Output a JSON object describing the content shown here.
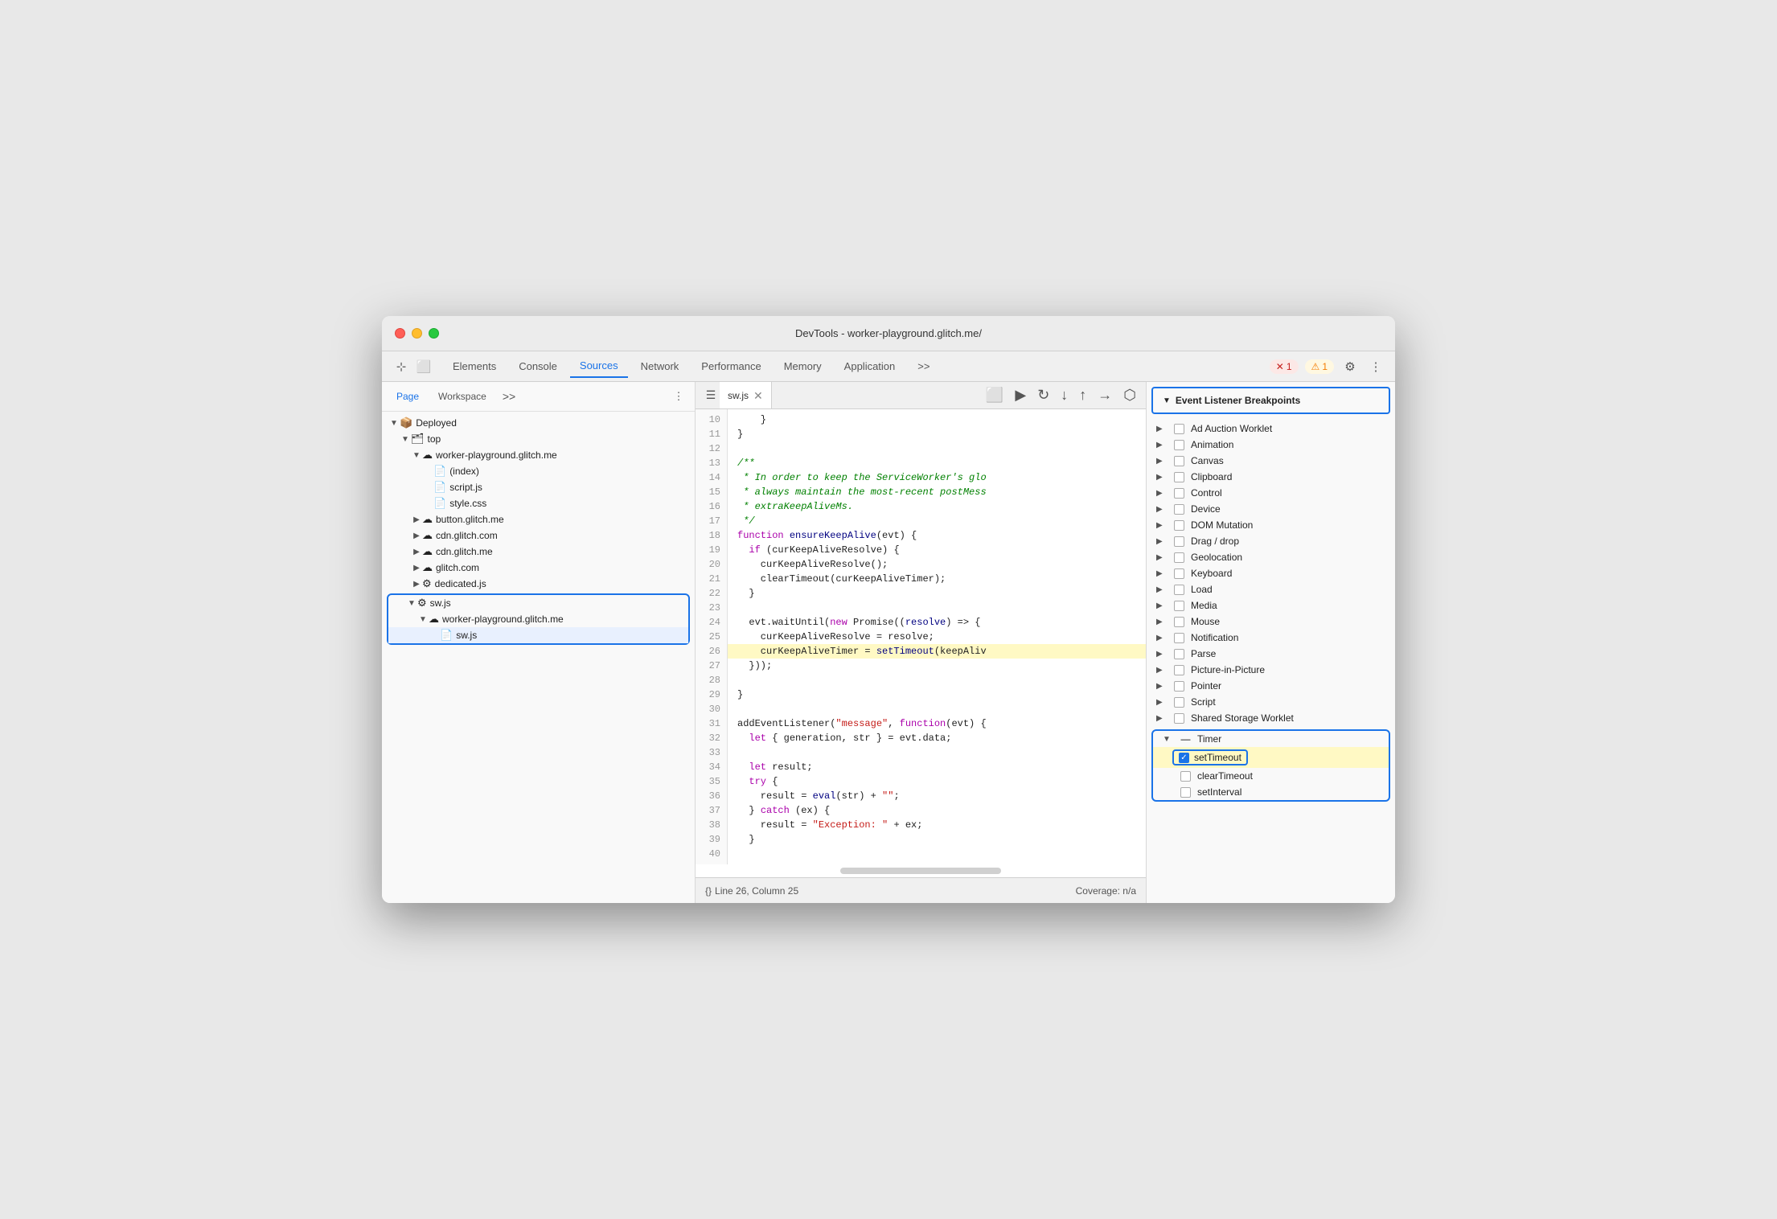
{
  "window": {
    "title": "DevTools - worker-playground.glitch.me/"
  },
  "tabs": [
    {
      "id": "elements",
      "label": "Elements"
    },
    {
      "id": "console",
      "label": "Console"
    },
    {
      "id": "sources",
      "label": "Sources",
      "active": true
    },
    {
      "id": "network",
      "label": "Network"
    },
    {
      "id": "performance",
      "label": "Performance"
    },
    {
      "id": "memory",
      "label": "Memory"
    },
    {
      "id": "application",
      "label": "Application"
    },
    {
      "id": "more",
      "label": ">>"
    }
  ],
  "error_count": "1",
  "warn_count": "1",
  "sidebar": {
    "tabs": [
      {
        "id": "page",
        "label": "Page",
        "active": true
      },
      {
        "id": "workspace",
        "label": "Workspace"
      },
      {
        "id": "more",
        "label": ">>"
      }
    ],
    "tree": [
      {
        "indent": 0,
        "toggle": "▼",
        "icon": "📦",
        "label": "Deployed"
      },
      {
        "indent": 1,
        "toggle": "▼",
        "icon": "🗂",
        "label": "top"
      },
      {
        "indent": 2,
        "toggle": "▼",
        "icon": "☁",
        "label": "worker-playground.glitch.me"
      },
      {
        "indent": 3,
        "toggle": "",
        "icon": "📄",
        "label": "(index)"
      },
      {
        "indent": 3,
        "toggle": "",
        "icon": "🟧",
        "label": "script.js"
      },
      {
        "indent": 3,
        "toggle": "",
        "icon": "🟪",
        "label": "style.css"
      },
      {
        "indent": 2,
        "toggle": "▶",
        "icon": "☁",
        "label": "button.glitch.me"
      },
      {
        "indent": 2,
        "toggle": "▶",
        "icon": "☁",
        "label": "cdn.glitch.com"
      },
      {
        "indent": 2,
        "toggle": "▶",
        "icon": "☁",
        "label": "cdn.glitch.me"
      },
      {
        "indent": 2,
        "toggle": "▶",
        "icon": "☁",
        "label": "glitch.com"
      },
      {
        "indent": 2,
        "toggle": "▶",
        "icon": "⚙",
        "label": "dedicated.js"
      },
      {
        "indent": 1,
        "toggle": "▼",
        "icon": "⚙",
        "label": "sw.js",
        "highlight_start": true
      },
      {
        "indent": 2,
        "toggle": "▼",
        "icon": "☁",
        "label": "worker-playground.glitch.me"
      },
      {
        "indent": 3,
        "toggle": "",
        "icon": "🟧",
        "label": "sw.js",
        "highlight_end": true
      }
    ]
  },
  "editor": {
    "file_tab": "sw.js",
    "lines": [
      {
        "num": 10,
        "code": "    }"
      },
      {
        "num": 11,
        "code": "}"
      },
      {
        "num": 12,
        "code": ""
      },
      {
        "num": 13,
        "code": "/**"
      },
      {
        "num": 14,
        "code": " * In order to keep the ServiceWorker's glo"
      },
      {
        "num": 15,
        "code": " * always maintain the most-recent postMess"
      },
      {
        "num": 16,
        "code": " * extraKeepAliveMs."
      },
      {
        "num": 17,
        "code": " */"
      },
      {
        "num": 18,
        "code": "function ensureKeepAlive(evt) {"
      },
      {
        "num": 19,
        "code": "  if (curKeepAliveResolve) {"
      },
      {
        "num": 20,
        "code": "    curKeepAliveResolve();"
      },
      {
        "num": 21,
        "code": "    clearTimeout(curKeepAliveTimer);"
      },
      {
        "num": 22,
        "code": "  }"
      },
      {
        "num": 23,
        "code": ""
      },
      {
        "num": 24,
        "code": "  evt.waitUntil(new Promise((resolve) => {"
      },
      {
        "num": 25,
        "code": "    curKeepAliveResolve = resolve;"
      },
      {
        "num": 26,
        "code": "    curKeepAliveTimer = setTimeout(keepAliv",
        "highlight": true
      },
      {
        "num": 27,
        "code": "  }));"
      },
      {
        "num": 28,
        "code": ""
      },
      {
        "num": 29,
        "code": "}"
      },
      {
        "num": 30,
        "code": ""
      },
      {
        "num": 31,
        "code": "addEventListener(\"message\", function(evt) {"
      },
      {
        "num": 32,
        "code": "  let { generation, str } = evt.data;"
      },
      {
        "num": 33,
        "code": ""
      },
      {
        "num": 34,
        "code": "  let result;"
      },
      {
        "num": 35,
        "code": "  try {"
      },
      {
        "num": 36,
        "code": "    result = eval(str) + \"\";"
      },
      {
        "num": 37,
        "code": "  } catch (ex) {"
      },
      {
        "num": 38,
        "code": "    result = \"Exception: \" + ex;"
      },
      {
        "num": 39,
        "code": "  }"
      },
      {
        "num": 40,
        "code": ""
      }
    ],
    "status": {
      "line": "26",
      "col": "25",
      "coverage": "Coverage: n/a"
    }
  },
  "breakpoints": {
    "header": "Event Listener Breakpoints",
    "items": [
      {
        "id": "ad-auction",
        "label": "Ad Auction Worklet",
        "toggle": "▶",
        "checked": false
      },
      {
        "id": "animation",
        "label": "Animation",
        "toggle": "▶",
        "checked": false
      },
      {
        "id": "canvas",
        "label": "Canvas",
        "toggle": "▶",
        "checked": false
      },
      {
        "id": "clipboard",
        "label": "Clipboard",
        "toggle": "▶",
        "checked": false
      },
      {
        "id": "control",
        "label": "Control",
        "toggle": "▶",
        "checked": false
      },
      {
        "id": "device",
        "label": "Device",
        "toggle": "▶",
        "checked": false
      },
      {
        "id": "dom-mutation",
        "label": "DOM Mutation",
        "toggle": "▶",
        "checked": false
      },
      {
        "id": "drag-drop",
        "label": "Drag / drop",
        "toggle": "▶",
        "checked": false
      },
      {
        "id": "geolocation",
        "label": "Geolocation",
        "toggle": "▶",
        "checked": false
      },
      {
        "id": "keyboard",
        "label": "Keyboard",
        "toggle": "▶",
        "checked": false
      },
      {
        "id": "load",
        "label": "Load",
        "toggle": "▶",
        "checked": false
      },
      {
        "id": "media",
        "label": "Media",
        "toggle": "▶",
        "checked": false
      },
      {
        "id": "mouse",
        "label": "Mouse",
        "toggle": "▶",
        "checked": false
      },
      {
        "id": "notification",
        "label": "Notification",
        "toggle": "▶",
        "checked": false
      },
      {
        "id": "parse",
        "label": "Parse",
        "toggle": "▶",
        "checked": false
      },
      {
        "id": "picture-in-picture",
        "label": "Picture-in-Picture",
        "toggle": "▶",
        "checked": false
      },
      {
        "id": "pointer",
        "label": "Pointer",
        "toggle": "▶",
        "checked": false
      },
      {
        "id": "script",
        "label": "Script",
        "toggle": "▶",
        "checked": false
      },
      {
        "id": "shared-storage",
        "label": "Shared Storage Worklet",
        "toggle": "▶",
        "checked": false
      }
    ],
    "timer": {
      "header_label": "Timer",
      "items": [
        {
          "id": "set-timeout",
          "label": "setTimeout",
          "checked": true,
          "highlighted": true
        },
        {
          "id": "clear-timeout",
          "label": "clearTimeout",
          "checked": false
        },
        {
          "id": "set-interval",
          "label": "setInterval",
          "checked": false
        }
      ]
    }
  }
}
